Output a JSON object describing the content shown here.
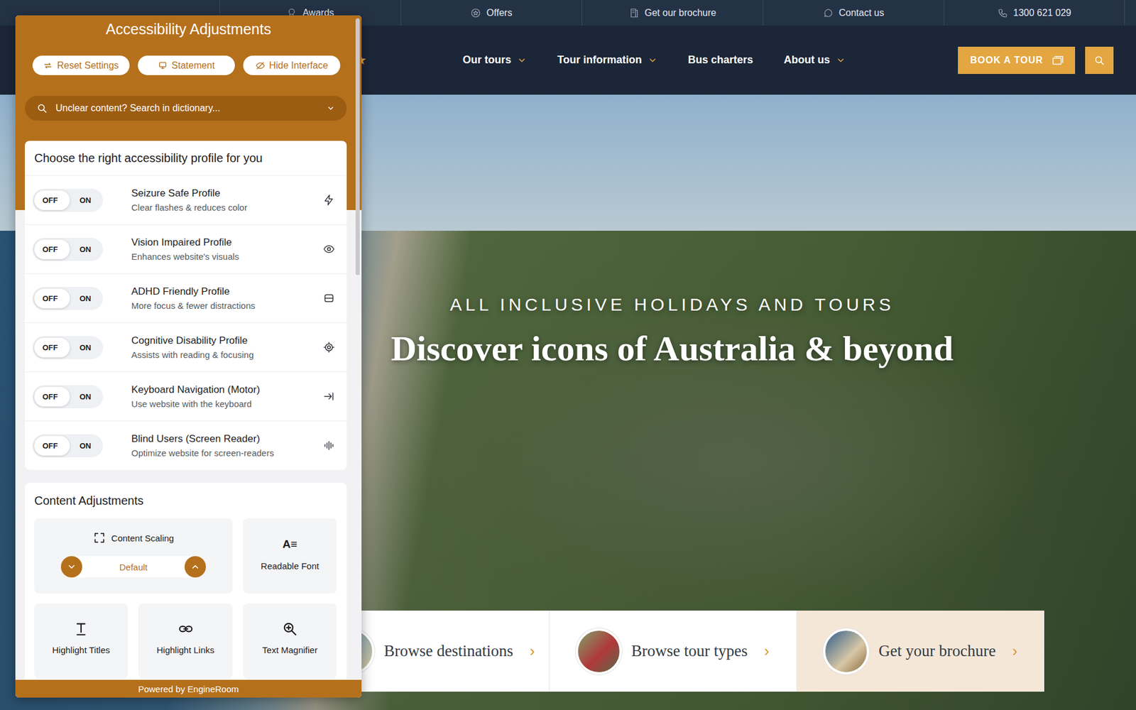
{
  "top_bar": {
    "items": [
      {
        "label": "Awards"
      },
      {
        "label": "Offers"
      },
      {
        "label": "Get our brochure"
      },
      {
        "label": "Contact us"
      },
      {
        "label": "1300 621 029"
      }
    ]
  },
  "header": {
    "logo_star": "★",
    "nav": [
      {
        "label": "Our tours",
        "has_dropdown": true
      },
      {
        "label": "Tour information",
        "has_dropdown": true
      },
      {
        "label": "Bus charters",
        "has_dropdown": false
      },
      {
        "label": "About us",
        "has_dropdown": true
      }
    ],
    "book_button": "BOOK A TOUR"
  },
  "hero": {
    "eyebrow": "ALL INCLUSIVE HOLIDAYS AND TOURS",
    "title": "Discover icons of Australia & beyond"
  },
  "cards": [
    {
      "label": "Browse destinations",
      "arrow": "›",
      "highlighted": false
    },
    {
      "label": "Browse tour types",
      "arrow": "›",
      "highlighted": false
    },
    {
      "label": "Get your brochure",
      "arrow": "›",
      "highlighted": true
    }
  ],
  "accessibility_panel": {
    "title": "Accessibility Adjustments",
    "buttons": [
      {
        "label": "Reset Settings"
      },
      {
        "label": "Statement"
      },
      {
        "label": "Hide Interface"
      }
    ],
    "dictionary_search": {
      "placeholder": "Unclear content? Search in dictionary..."
    },
    "profiles": {
      "heading": "Choose the right accessibility profile for you",
      "items": [
        {
          "title": "Seizure Safe Profile",
          "subtitle": "Clear flashes & reduces color",
          "off_label": "OFF",
          "on_label": "ON",
          "on": false
        },
        {
          "title": "Vision Impaired Profile",
          "subtitle": "Enhances website's visuals",
          "off_label": "OFF",
          "on_label": "ON",
          "on": false
        },
        {
          "title": "ADHD Friendly Profile",
          "subtitle": "More focus & fewer distractions",
          "off_label": "OFF",
          "on_label": "ON",
          "on": false
        },
        {
          "title": "Cognitive Disability Profile",
          "subtitle": "Assists with reading & focusing",
          "off_label": "OFF",
          "on_label": "ON",
          "on": false
        },
        {
          "title": "Keyboard Navigation (Motor)",
          "subtitle": "Use website with the keyboard",
          "off_label": "OFF",
          "on_label": "ON",
          "on": false
        },
        {
          "title": "Blind Users (Screen Reader)",
          "subtitle": "Optimize website for screen-readers",
          "off_label": "OFF",
          "on_label": "ON",
          "on": false
        }
      ]
    },
    "content_adjustments": {
      "heading": "Content Adjustments",
      "scaling": {
        "label": "Content Scaling",
        "value": "Default"
      },
      "tiles": [
        {
          "label": "Readable Font",
          "icon_text": "A≡"
        },
        {
          "label": "Highlight Titles"
        },
        {
          "label": "Highlight Links"
        },
        {
          "label": "Text Magnifier"
        }
      ]
    },
    "footer": "Powered by EngineRoom"
  }
}
